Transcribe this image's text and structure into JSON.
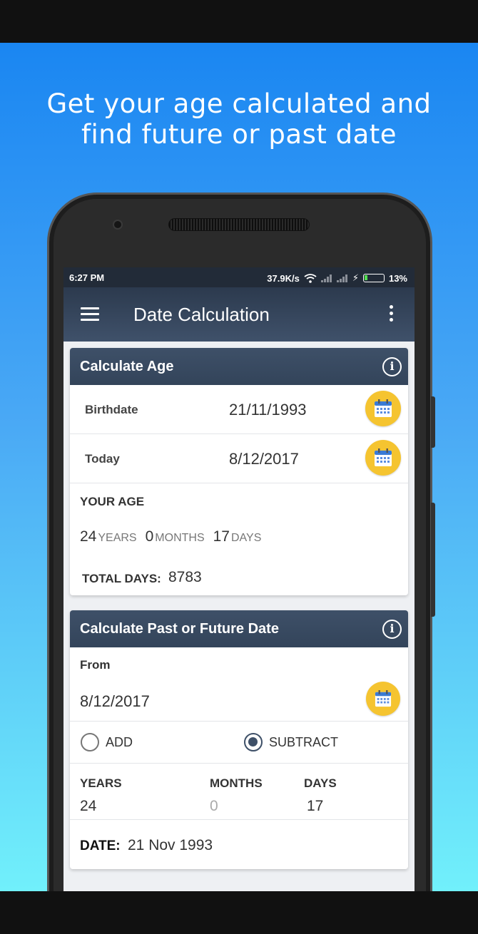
{
  "promo": {
    "line1": "Get your age calculated and",
    "line2": "find future or past date"
  },
  "status": {
    "time": "6:27 PM",
    "speed": "37.9K/s",
    "battery": "13%"
  },
  "appbar": {
    "title": "Date Calculation"
  },
  "age_card": {
    "title": "Calculate Age",
    "birthdate_label": "Birthdate",
    "birthdate_value": "21/11/1993",
    "today_label": "Today",
    "today_value": "8/12/2017",
    "your_age_label": "YOUR AGE",
    "years_value": "24",
    "years_unit": "YEARS",
    "months_value": "0",
    "months_unit": "MONTHS",
    "days_value": "17",
    "days_unit": "DAYS",
    "total_days_label": "TOTAL DAYS:",
    "total_days_value": "8783"
  },
  "date_card": {
    "title": "Calculate Past or Future Date",
    "from_label": "From",
    "from_value": "8/12/2017",
    "add_label": "ADD",
    "subtract_label": "SUBTRACT",
    "selected_mode": "SUBTRACT",
    "years_label": "YEARS",
    "years_value": "24",
    "months_label": "MONTHS",
    "months_value": "0",
    "days_label": "DAYS",
    "days_value": "17",
    "date_label": "DATE:",
    "date_value": "21 Nov 1993"
  },
  "colors": {
    "accent": "#f5c430",
    "header": "#3e5068"
  }
}
